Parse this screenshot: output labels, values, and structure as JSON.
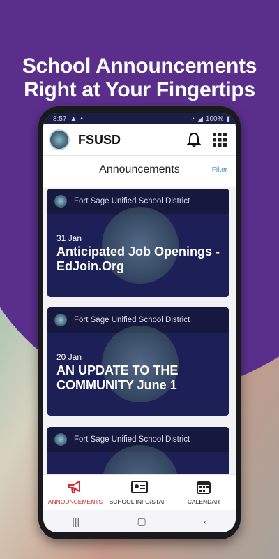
{
  "headline": {
    "line1": "School Announcements",
    "line2": "Right at Your Fingertips"
  },
  "status": {
    "time": "8:57",
    "battery": "100%"
  },
  "app": {
    "name": "FSUSD",
    "icons": [
      "bell-icon",
      "grid-menu-icon"
    ]
  },
  "subheader": {
    "title": "Announcements",
    "filter": "Filter"
  },
  "cards": [
    {
      "source": "Fort Sage Unified School District",
      "date": "31 Jan",
      "title": "Anticipated Job Openings - EdJoin.Org"
    },
    {
      "source": "Fort Sage Unified School District",
      "date": "20 Jan",
      "title": "AN UPDATE TO THE COMMUNITY June 1"
    },
    {
      "source": "Fort Sage Unified School District",
      "date": "",
      "title": ""
    }
  ],
  "nav": [
    {
      "label": "ANNOUNCEMENTS",
      "icon": "megaphone-icon",
      "active": true
    },
    {
      "label": "SCHOOL INFO/STAFF",
      "icon": "id-card-icon",
      "active": false
    },
    {
      "label": "CALENDAR",
      "icon": "calendar-icon",
      "active": false
    }
  ],
  "colors": {
    "purple": "#5a2f8c",
    "navy": "#1d2056",
    "active": "#d42a2a",
    "link": "#3b8fd6"
  }
}
